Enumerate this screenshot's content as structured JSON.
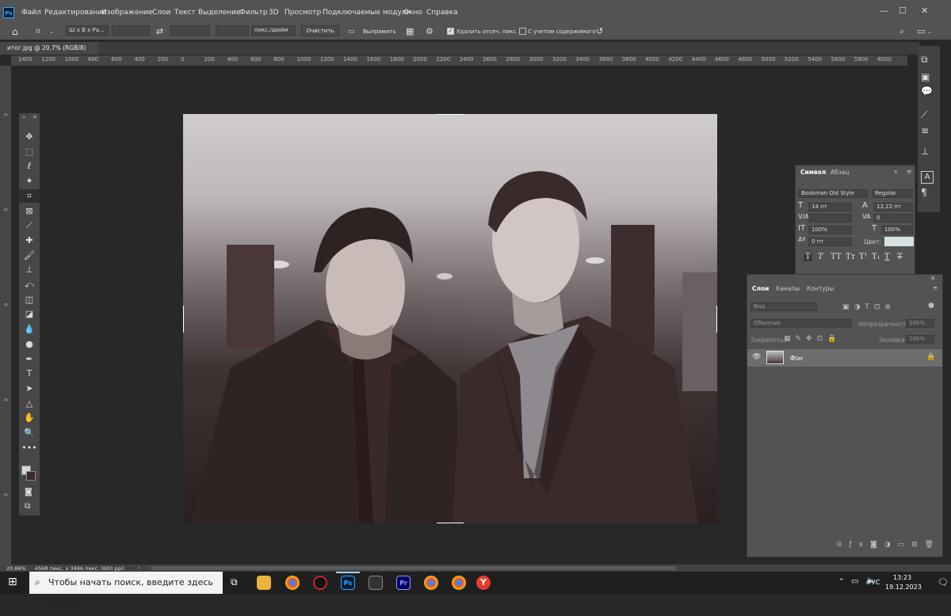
{
  "menubar": {
    "logo": "Ps",
    "items": [
      "Файл",
      "Редактирование",
      "Изображение",
      "Слои",
      "Текст",
      "Выделение",
      "Фильтр",
      "3D",
      "Просмотр",
      "Подключаемые модули",
      "Окно",
      "Справка"
    ]
  },
  "options_bar": {
    "ratio_preset": "Ш x В x Ра...",
    "units": "пикс./дюйм",
    "clear_label": "Очистить",
    "straighten_label": "Выпрямить",
    "delete_cropped_label": "Удалить отсеч. пикс.",
    "delete_cropped_checked": true,
    "content_aware_label": "С учетом содержимого",
    "content_aware_checked": false
  },
  "document_tab": {
    "title": "итог.jpg @ 20,7% (RGB/8)",
    "close": "×"
  },
  "ruler": {
    "horizontal": [
      "1400",
      "1200",
      "1000",
      "800",
      "600",
      "400",
      "200",
      "0",
      "200",
      "400",
      "600",
      "800",
      "1000",
      "1200",
      "1400",
      "1600",
      "1800",
      "2000",
      "2200",
      "2400",
      "2600",
      "2800",
      "3000",
      "3200",
      "3400",
      "3600",
      "3800",
      "4000",
      "4200",
      "4400",
      "4600",
      "4800",
      "5000",
      "5200",
      "5400",
      "5600",
      "5800",
      "6000"
    ]
  },
  "tools": [
    "move-icon",
    "marquee-icon",
    "lasso-icon",
    "magic-wand-icon",
    "crop-icon",
    "frame-icon",
    "eyedropper-icon",
    "healing-icon",
    "brush-icon",
    "stamp-icon",
    "history-brush-icon",
    "eraser-icon",
    "bucket-icon",
    "blur-icon",
    "dodge-icon",
    "pen-icon",
    "type-icon",
    "path-select-icon",
    "shape-icon",
    "hand-icon",
    "zoom-icon",
    "more-icon"
  ],
  "tool_glyphs": [
    "✥",
    "⬚",
    "ℓ",
    "✦",
    "⌗",
    "⊠",
    "⟋",
    "✚",
    "🖌",
    "⊥",
    "⤺",
    "◫",
    "◪",
    "💧",
    "●",
    "✒",
    "T",
    "➤",
    "△",
    "✋",
    "🔍",
    "•••"
  ],
  "colors": {
    "foreground": "#d0d8d8",
    "background": "#3a2a2a",
    "accent": "#31a8ff"
  },
  "character_panel": {
    "tabs": [
      "Символ",
      "Абзац"
    ],
    "font_family": "Bookman Old Style",
    "font_style": "Regular",
    "font_size": "14 пт",
    "leading": "13,22 пт",
    "tracking": "0",
    "vertical_scale": "100%",
    "horizontal_scale": "100%",
    "baseline_shift": "0 пт",
    "color_label": "Цвет:",
    "text_color": "#d7e1e1"
  },
  "layers_panel": {
    "tabs": [
      "Слои",
      "Каналы",
      "Контуры"
    ],
    "search_placeholder": "Вид",
    "blend_mode": "Обычные",
    "opacity_label": "Непрозрачность:",
    "opacity_value": "100%",
    "lock_label": "Закрепить:",
    "fill_label": "Заливка:",
    "fill_value": "100%",
    "layers": [
      {
        "name": "Фон",
        "visible": true,
        "locked": true
      }
    ]
  },
  "status_bar": {
    "zoom": "20,66%",
    "doc_info": "4568 пикс. x 3496 пикс. (600 ppi)"
  },
  "taskbar": {
    "search_placeholder": "Чтобы начать поиск, введите здесь запрос",
    "language": "РУС",
    "time": "13:23",
    "date": "19.12.2023"
  }
}
